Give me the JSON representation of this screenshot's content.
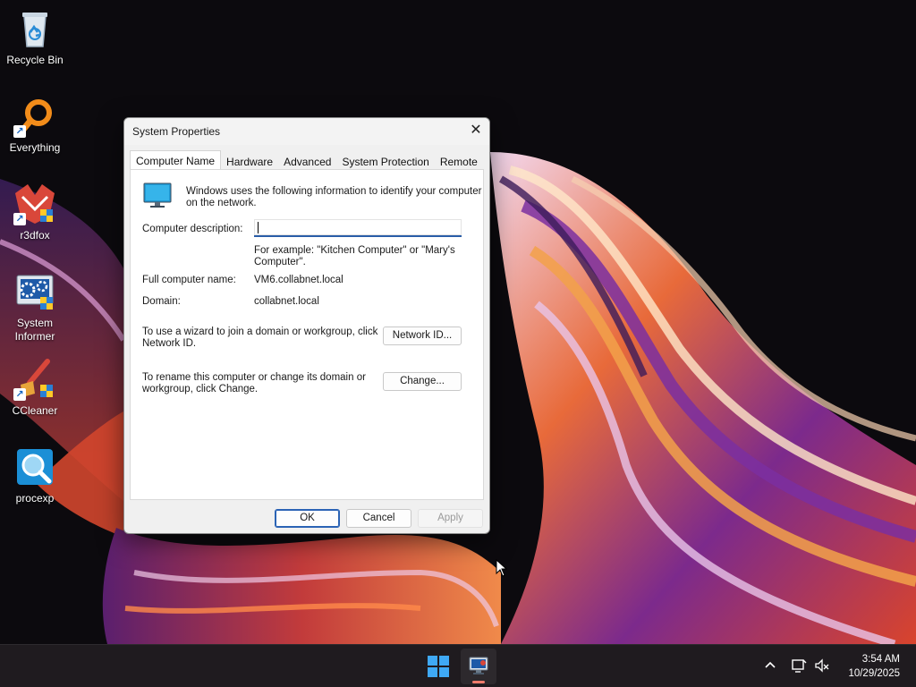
{
  "desktop": {
    "icons": [
      {
        "label": "Recycle Bin",
        "icon": "recycle-bin-icon"
      },
      {
        "label": "Everything",
        "icon": "magnifier-icon"
      },
      {
        "label": "r3dfox",
        "icon": "r3dfox-icon"
      },
      {
        "label": "System Informer",
        "icon": "system-informer-icon"
      },
      {
        "label": "CCleaner",
        "icon": "ccleaner-icon"
      },
      {
        "label": "procexp",
        "icon": "procexp-icon"
      }
    ]
  },
  "dialog": {
    "title": "System Properties",
    "close_glyph": "✕",
    "tabs": [
      {
        "label": "Computer Name",
        "active": true
      },
      {
        "label": "Hardware",
        "active": false
      },
      {
        "label": "Advanced",
        "active": false
      },
      {
        "label": "System Protection",
        "active": false
      },
      {
        "label": "Remote",
        "active": false
      }
    ],
    "intro_line1": "Windows uses the following information to identify your computer",
    "intro_line2": "on the network.",
    "computer_description_label": "Computer description:",
    "computer_description_value": "",
    "example_line1": "For example: \"Kitchen Computer\" or \"Mary's",
    "example_line2": "Computer\".",
    "full_name_label": "Full computer name:",
    "full_name_value": "VM6.collabnet.local",
    "domain_label": "Domain:",
    "domain_value": "collabnet.local",
    "wizard_line1": "To use a wizard to join a domain or workgroup, click",
    "wizard_line2": "Network ID.",
    "network_id_button": "Network ID...",
    "rename_line1": "To rename this computer or change its domain or",
    "rename_line2": "workgroup, click Change.",
    "change_button": "Change...",
    "ok_button": "OK",
    "cancel_button": "Cancel",
    "apply_button": "Apply"
  },
  "taskbar": {
    "start_icon": "windows-start-icon",
    "pinned_app_icon": "system-properties-icon",
    "tray": {
      "chevron": "^",
      "time": "3:54 AM",
      "date": "10/29/2025"
    }
  },
  "colors": {
    "accent": "#2b63b5",
    "taskbar": "#1f1b1f",
    "active_indicator": "#f07c6c"
  }
}
